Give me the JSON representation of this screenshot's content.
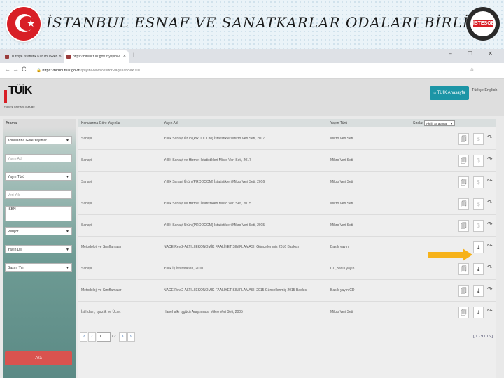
{
  "slide": {
    "title": "İSTANBUL ESNAF VE SANATKARLAR ODALARI BİRLİĞİ",
    "logo_text": "İSTESOB",
    "flag_star": "★"
  },
  "browser": {
    "tabs": [
      {
        "label": "Türkiye İstatistik Kurumu Web"
      },
      {
        "label": "https://biruni.tuik.gov.tr/yayin/v"
      }
    ],
    "new_tab": "+",
    "close": "×",
    "window_controls": "– ☐ ✕",
    "nav": {
      "back": "←",
      "forward": "→",
      "reload": "C"
    },
    "url_host": "https://biruni.tuik.gov.tr",
    "url_path": "/yayin/views/visitorPages/index.zul",
    "addr_icons": "☆ ⋮"
  },
  "site": {
    "logo_text": "TÜİK",
    "logo_sub": "TÜRKİYE İSTATİSTİK KURUMU",
    "home_button": "TÜİK Anasayfa",
    "lang": "Türkçe   English"
  },
  "sidebar": {
    "header": "Arama",
    "collapse": "‹",
    "controls": [
      {
        "label": "Konularına Göre Yayınlar",
        "kind": "select"
      },
      {
        "label": "Yayın Adı",
        "kind": "input"
      },
      {
        "label": "Yayın Türü",
        "kind": "select"
      },
      {
        "label": "Veri Yılı",
        "kind": "input"
      },
      {
        "label": "ISBN",
        "kind": "textarea"
      },
      {
        "label": "Periyot",
        "kind": "select"
      },
      {
        "label": "Yayın Dili",
        "kind": "select"
      },
      {
        "label": "Basım Yılı",
        "kind": "select"
      }
    ],
    "search_button": "Ara",
    "dropdown_arrow": "▼"
  },
  "table": {
    "headers": [
      "Konularına Göre Yayınlar",
      "Yayın Adı",
      "Yayın Türü"
    ],
    "sort_label": "Sırala:",
    "sort_value": "Akıllı Sıralama",
    "rows": [
      {
        "topic": "Sanayi",
        "name": "Yıllık Sanayi Ürün (PRODCOM) İstatistikleri Mikro Veri Seti, 2017",
        "type": "Mikro Veri Seti",
        "btn1": "🗐",
        "btn2": "$",
        "btn2_enabled": false
      },
      {
        "topic": "Sanayi",
        "name": "Yıllık Sanayi ve Hizmet İstatistikleri Mikro Veri Seti, 2017",
        "type": "Mikro Veri Seti",
        "btn1": "🗐",
        "btn2": "$",
        "btn2_enabled": false
      },
      {
        "topic": "Sanayi",
        "name": "Yıllık Sanayi Ürün (PRODCOM) İstatistikleri Mikro Veri Seti, 2016",
        "type": "Mikro Veri Seti",
        "btn1": "🗐",
        "btn2": "$",
        "btn2_enabled": false
      },
      {
        "topic": "Sanayi",
        "name": "Yıllık Sanayi ve Hizmet İstatistikleri Mikro Veri Seti, 2015",
        "type": "Mikro Veri Seti",
        "btn1": "🗐",
        "btn2": "$",
        "btn2_enabled": false
      },
      {
        "topic": "Sanayi",
        "name": "Yıllık Sanayi Ürün (PRODCOM) İstatistikleri Mikro Veri Seti, 2015",
        "type": "Mikro Veri Seti",
        "btn1": "🗐",
        "btn2": "$",
        "btn2_enabled": false
      },
      {
        "topic": "Metodoloji ve Sınıflamalar",
        "name": "NACE Rev.2-ALTILI EKONOMİK FAALİYET SINIFLAMASI, Güncellenmiş 2016 Baskısı",
        "type": "Basılı yayın",
        "btn1": "",
        "btn2": "⤓",
        "btn2_enabled": true
      },
      {
        "topic": "Sanayi",
        "name": "Yıllık İş İstatistikleri, 2010",
        "type": "CD,Basılı yayın",
        "btn1": "🗐",
        "btn2": "⤓",
        "btn2_enabled": true
      },
      {
        "topic": "Metodoloji ve Sınıflamalar",
        "name": "NACE Rev.2-ALTILI EKONOMİK FAALİYET SINIFLAMASI, 2015 Güncellenmiş 2015 Baskısı",
        "type": "Basılı yayın,CD",
        "btn1": "🗐",
        "btn2": "⤓",
        "btn2_enabled": true
      },
      {
        "topic": "İstihdam, İşsizlik ve Ücret",
        "name": "Hanehalkı İşgücü Araştırması Mikro Veri Seti, 2005",
        "type": "Mikro Veri Seti",
        "btn1": "🗐",
        "btn2": "⤓",
        "btn2_enabled": true
      }
    ],
    "share_icon": "↷"
  },
  "pager": {
    "first": "|‹",
    "prev": "‹",
    "current": "1",
    "of": "/ 2",
    "next": "›",
    "last": "›|",
    "count": "[ 1 - 9 / 16 ]"
  },
  "annotation": {
    "arrow_color": "#f6b21a"
  }
}
